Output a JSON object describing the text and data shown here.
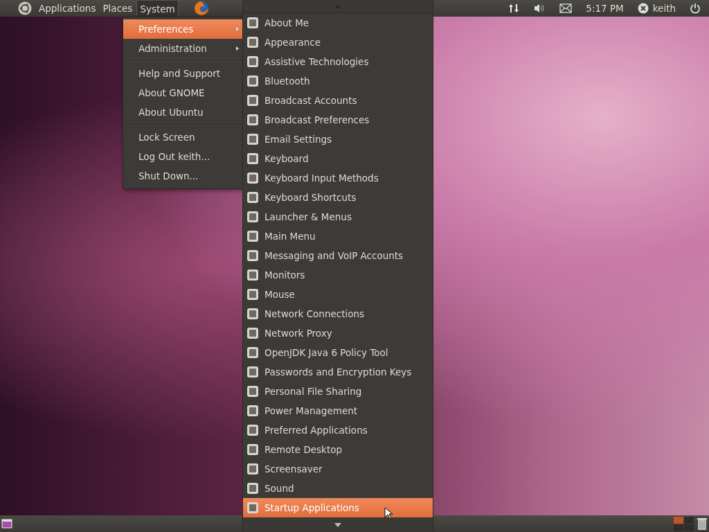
{
  "top_panel": {
    "menus": [
      {
        "label": "Applications",
        "selected": false
      },
      {
        "label": "Places",
        "selected": false
      },
      {
        "label": "System",
        "selected": true
      }
    ],
    "clock": "5:17 PM",
    "user": "keith"
  },
  "system_menu": {
    "groups": [
      [
        {
          "label": "Preferences",
          "kind": "submenu",
          "selected": true
        },
        {
          "label": "Administration",
          "kind": "submenu",
          "selected": false
        }
      ],
      [
        {
          "label": "Help and Support",
          "kind": "item",
          "selected": false
        },
        {
          "label": "About GNOME",
          "kind": "item",
          "selected": false
        },
        {
          "label": "About Ubuntu",
          "kind": "item",
          "selected": false
        }
      ],
      [
        {
          "label": "Lock Screen",
          "kind": "item",
          "selected": false
        },
        {
          "label": "Log Out keith...",
          "kind": "item",
          "selected": false
        },
        {
          "label": "Shut Down...",
          "kind": "item",
          "selected": false
        }
      ]
    ]
  },
  "preferences_menu": {
    "items": [
      {
        "label": "About Me",
        "selected": false
      },
      {
        "label": "Appearance",
        "selected": false
      },
      {
        "label": "Assistive Technologies",
        "selected": false
      },
      {
        "label": "Bluetooth",
        "selected": false
      },
      {
        "label": "Broadcast Accounts",
        "selected": false
      },
      {
        "label": "Broadcast Preferences",
        "selected": false
      },
      {
        "label": "Email Settings",
        "selected": false
      },
      {
        "label": "Keyboard",
        "selected": false
      },
      {
        "label": "Keyboard Input Methods",
        "selected": false
      },
      {
        "label": "Keyboard Shortcuts",
        "selected": false
      },
      {
        "label": "Launcher & Menus",
        "selected": false
      },
      {
        "label": "Main Menu",
        "selected": false
      },
      {
        "label": "Messaging and VoIP Accounts",
        "selected": false
      },
      {
        "label": "Monitors",
        "selected": false
      },
      {
        "label": "Mouse",
        "selected": false
      },
      {
        "label": "Network Connections",
        "selected": false
      },
      {
        "label": "Network Proxy",
        "selected": false
      },
      {
        "label": "OpenJDK Java 6 Policy Tool",
        "selected": false
      },
      {
        "label": "Passwords and Encryption Keys",
        "selected": false
      },
      {
        "label": "Personal File Sharing",
        "selected": false
      },
      {
        "label": "Power Management",
        "selected": false
      },
      {
        "label": "Preferred Applications",
        "selected": false
      },
      {
        "label": "Remote Desktop",
        "selected": false
      },
      {
        "label": "Screensaver",
        "selected": false
      },
      {
        "label": "Sound",
        "selected": false
      },
      {
        "label": "Startup Applications",
        "selected": true
      }
    ]
  },
  "bottom_panel": {
    "workspaces": [
      {
        "selected": true
      },
      {
        "selected": false
      },
      {
        "selected": false
      },
      {
        "selected": false
      }
    ]
  }
}
